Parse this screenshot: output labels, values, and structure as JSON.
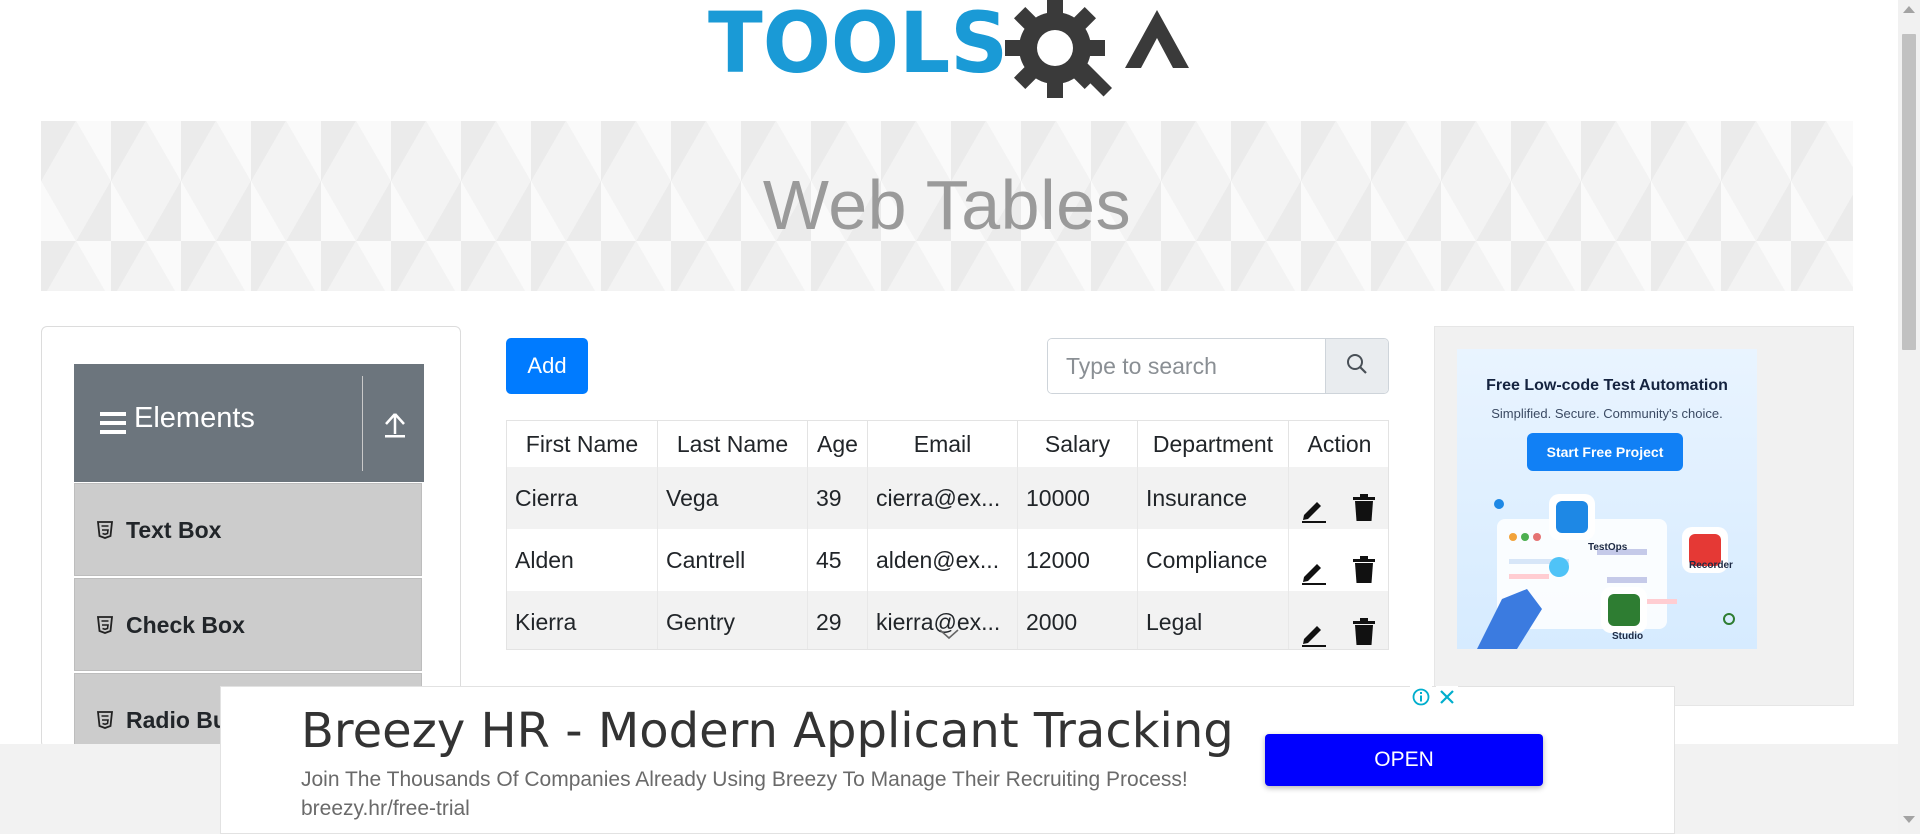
{
  "logo": {
    "text": "TOOLSQA"
  },
  "banner": {
    "title": "Web Tables"
  },
  "sidebar": {
    "group_title": "Elements",
    "items": [
      {
        "label": "Text Box"
      },
      {
        "label": "Check Box"
      },
      {
        "label": "Radio Bu"
      }
    ]
  },
  "toolbar": {
    "add_label": "Add",
    "search_placeholder": "Type to search"
  },
  "table": {
    "headers": [
      "First Name",
      "Last Name",
      "Age",
      "Email",
      "Salary",
      "Department",
      "Action"
    ],
    "rows": [
      [
        "Cierra",
        "Vega",
        "39",
        "cierra@ex...",
        "10000",
        "Insurance"
      ],
      [
        "Alden",
        "Cantrell",
        "45",
        "alden@ex...",
        "12000",
        "Compliance"
      ],
      [
        "Kierra",
        "Gentry",
        "29",
        "kierra@ex...",
        "2000",
        "Legal"
      ]
    ]
  },
  "right_ad": {
    "title": "Free Low-code Test Automation",
    "subtitle": "Simplified. Secure. Community's choice.",
    "cta": "Start Free Project",
    "labels": [
      "TestOps",
      "Recorder",
      "Studio"
    ]
  },
  "bottom_ad": {
    "title": "Breezy HR - Modern Applicant Tracking",
    "description": "Join The Thousands Of Companies Already Using Breezy To Manage Their Recruiting Process! breezy.hr/free-trial",
    "open_label": "OPEN"
  },
  "colors": {
    "primary": "#007bff",
    "sidebar_header": "#6c757d",
    "menu_item": "#cccccc",
    "logo_blue": "#1a9ad6",
    "logo_dark": "#333333",
    "ad_button": "#0000ff"
  }
}
